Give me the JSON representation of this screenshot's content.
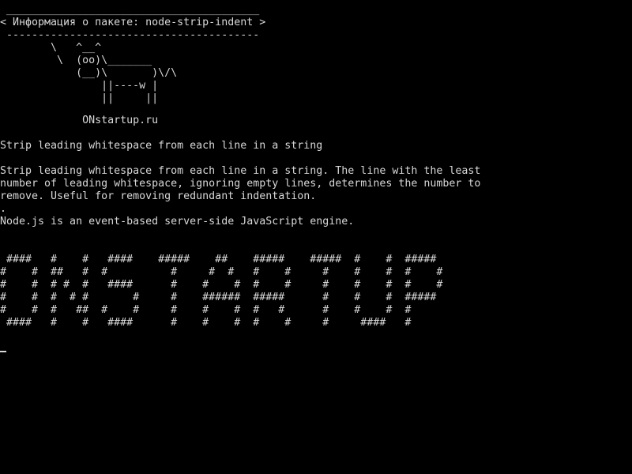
{
  "terminal": {
    "cowsay_lines": [
      " ________________________________________",
      "< Информация о пакете: node-strip-indent >",
      " ----------------------------------------",
      "        \\   ^__^",
      "         \\  (oo)\\_______",
      "            (__)\\       )\\/\\",
      "                ||----w |",
      "                ||     ||"
    ],
    "brand_line": "             ONstartup.ru",
    "description_lines": [
      "Strip leading whitespace from each line in a string",
      "",
      "Strip leading whitespace from each line in a string. The line with the least",
      "number of leading whitespace, ignoring empty lines, determines the number to",
      "remove. Useful for removing redundant indentation.",
      ".",
      "Node.js is an event-based server-side JavaScript engine."
    ],
    "banner_lines": [
      " ####   #    #   ####    #####    ##    #####    #####  #    #  #####",
      "#    #  ##   #  #          #     #  #   #    #     #    #    #  #    #",
      "#    #  # #  #   ####      #    #    #  #    #     #    #    #  #    #",
      "#    #  #  # #       #     #    ######  #####      #    #    #  #####",
      "#    #  #   ##  #    #     #    #    #  #   #      #    #    #  #",
      " ####   #    #   ####      #    #    #  #    #     #     ####   #"
    ]
  }
}
